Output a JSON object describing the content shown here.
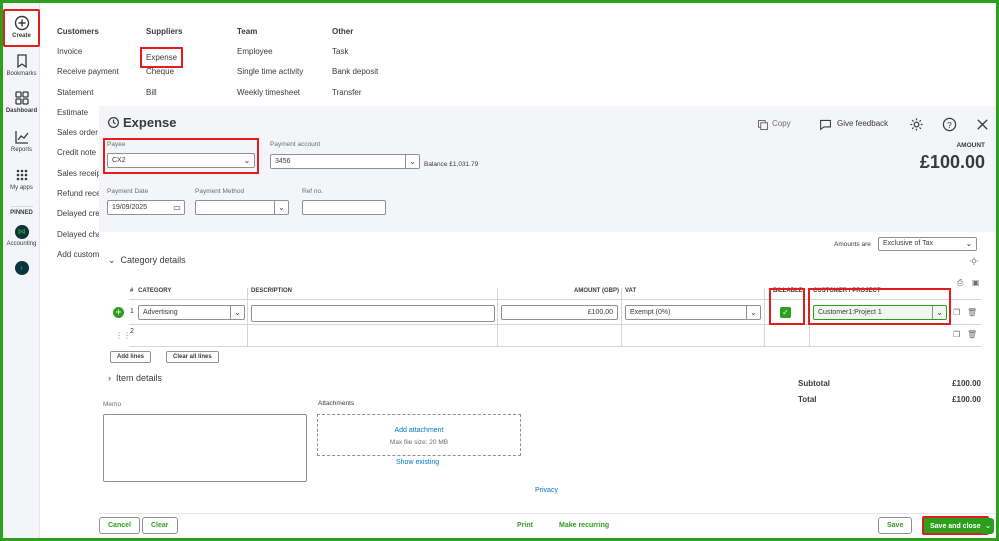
{
  "rail": {
    "items": [
      {
        "label": "Create",
        "icon": "plus-circle-icon"
      },
      {
        "label": "Bookmarks",
        "icon": "bookmark-icon"
      },
      {
        "label": "Dashboard",
        "icon": "dashboard-icon"
      },
      {
        "label": "Reports",
        "icon": "reports-icon"
      },
      {
        "label": "My apps",
        "icon": "apps-grid-icon"
      }
    ],
    "pinned_label": "PINNED",
    "pinned": [
      {
        "label": "Accounting",
        "icon": "accounting-icon"
      },
      {
        "label": "",
        "icon": "app-icon"
      }
    ]
  },
  "menu": {
    "customers": {
      "heading": "Customers",
      "items": [
        "Invoice",
        "Receive payment",
        "Statement",
        "Estimate",
        "Sales order",
        "Credit note",
        "Sales receipt",
        "Refund receipt",
        "Delayed credit",
        "Delayed charge",
        "Add customer"
      ]
    },
    "suppliers": {
      "heading": "Suppliers",
      "items": [
        "Expense",
        "Cheque",
        "Bill"
      ]
    },
    "team": {
      "heading": "Team",
      "items": [
        "Employee",
        "Single time activity",
        "Weekly timesheet"
      ]
    },
    "other": {
      "heading": "Other",
      "items": [
        "Task",
        "Bank deposit",
        "Transfer"
      ]
    }
  },
  "expense": {
    "title": "Expense",
    "copy_label": "Copy",
    "feedback_label": "Give feedback",
    "payee_label": "Payee",
    "payee_value": "CX2",
    "payment_account_label": "Payment account",
    "payment_account_value": "3456",
    "balance_text": "Balance £1,031.79",
    "amount_label": "AMOUNT",
    "amount_value": "£100.00",
    "payment_date_label": "Payment Date",
    "payment_date_value": "19/09/2025",
    "payment_method_label": "Payment Method",
    "payment_method_value": "",
    "ref_label": "Ref no.",
    "ref_value": "",
    "amounts_are_label": "Amounts are",
    "amounts_are_value": "Exclusive of Tax",
    "category_details": "Category details",
    "item_details": "Item details"
  },
  "table": {
    "headers": {
      "num": "#",
      "category": "CATEGORY",
      "description": "DESCRIPTION",
      "amount": "AMOUNT (GBP)",
      "vat": "VAT",
      "billable": "BILLABLE",
      "customer": "CUSTOMER / PROJECT"
    },
    "rows": [
      {
        "num": "1",
        "category": "Advertising",
        "description": "",
        "amount": "£100.00",
        "vat": "Exempt (0%)",
        "billable": true,
        "customer": "Customer1:Project 1"
      },
      {
        "num": "2",
        "category": "",
        "description": "",
        "amount": "",
        "vat": "",
        "billable": false,
        "customer": ""
      }
    ],
    "add_lines": "Add lines",
    "clear_all_lines": "Clear all lines"
  },
  "totals": {
    "subtotal_label": "Subtotal",
    "subtotal_value": "£100.00",
    "total_label": "Total",
    "total_value": "£100.00"
  },
  "memo_label": "Memo",
  "attachments": {
    "label": "Attachments",
    "add": "Add attachment",
    "max": "Max file size: 20 MB",
    "show": "Show existing"
  },
  "privacy": "Privacy",
  "footer": {
    "cancel": "Cancel",
    "clear": "Clear",
    "print": "Print",
    "make_recurring": "Make recurring",
    "save": "Save",
    "save_close": "Save and close"
  },
  "colors": {
    "accent": "#2ca01c",
    "highlight": "#e31c1c",
    "link": "#0077c5"
  }
}
